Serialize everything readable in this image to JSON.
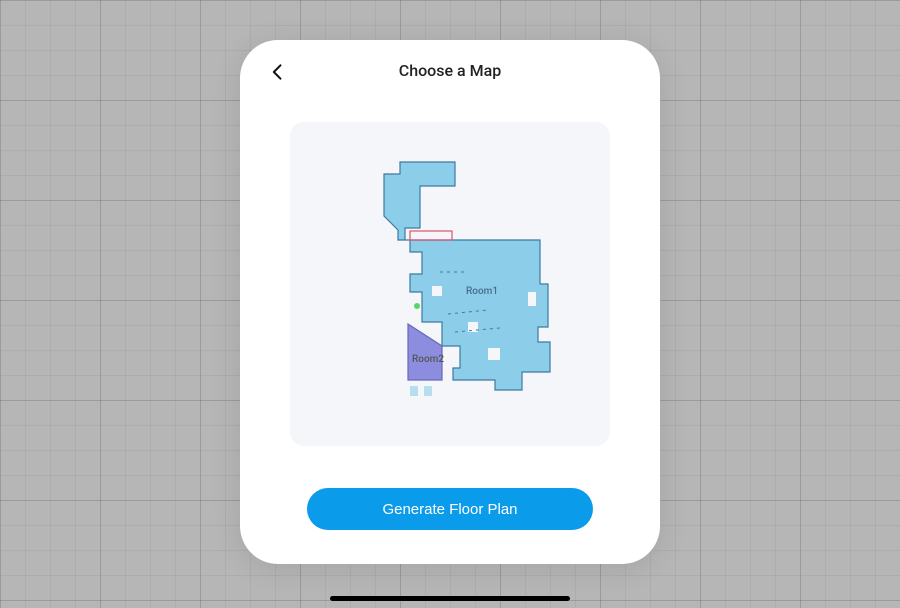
{
  "grid": {
    "baseColor": "#b6b6b6"
  },
  "modal": {
    "title": "Choose a Map",
    "generate_label": "Generate Floor Plan",
    "primary_color": "#0a9bea"
  },
  "map": {
    "panel_bg": "#f4f6f9",
    "rooms": [
      {
        "id": "room1",
        "label": "Room1",
        "fill": "#8cceea",
        "stroke": "#3d7aa0"
      },
      {
        "id": "room2",
        "label": "Room2",
        "fill": "#8d8de0",
        "stroke": "#6868b8"
      }
    ],
    "highlight_box_stroke": "#e0526a"
  },
  "home_indicator": {
    "color": "#000000"
  }
}
